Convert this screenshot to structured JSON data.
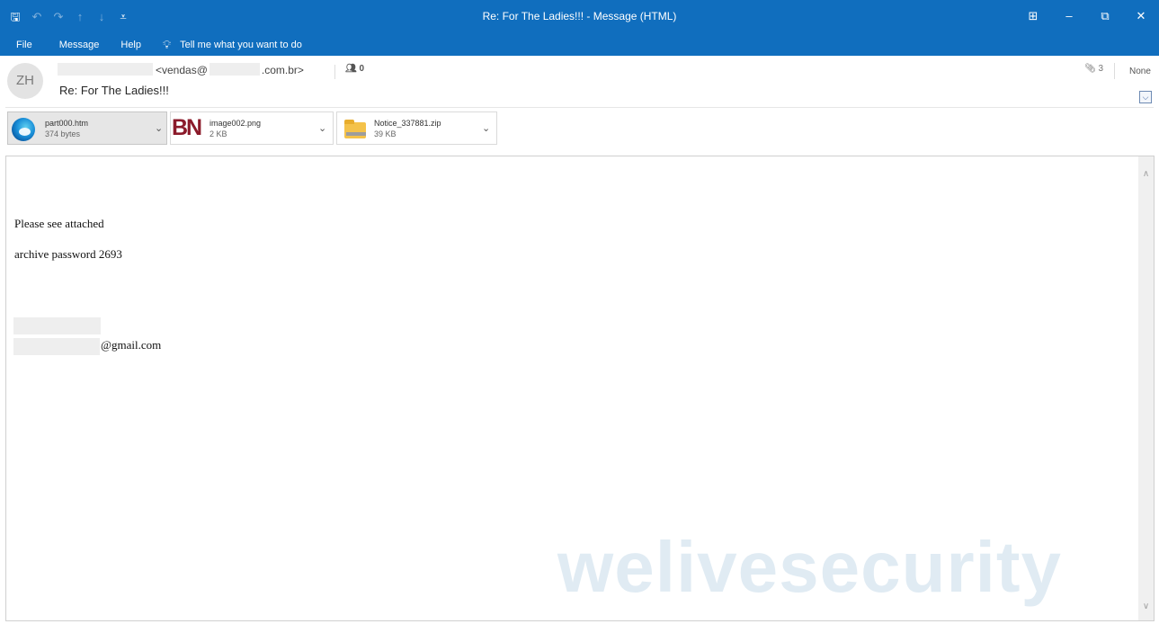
{
  "window": {
    "title": "Re: For The Ladies!!!  -  Message (HTML)",
    "controls": {
      "restore_ribbon": "⊞",
      "minimize": "–",
      "maximize": "⧉",
      "close": "✕"
    }
  },
  "quick_access": {
    "save": "🖫",
    "undo": "↶",
    "redo": "↷",
    "up": "↑",
    "down": "↓",
    "customize": "⩡"
  },
  "menu": {
    "file": "File",
    "message": "Message",
    "help": "Help",
    "tell_me": "Tell me what you want to do"
  },
  "header": {
    "avatar_initials": "ZH",
    "sender_email_prefix": "<vendas@",
    "sender_email_suffix": ".com.br>",
    "people_count": "0",
    "subject": "Re: For The Ladies!!!",
    "attachment_count": "3",
    "sensitivity": "None"
  },
  "attachments": [
    {
      "name": "part000.htm",
      "size": "374 bytes",
      "icon": "edge-icon"
    },
    {
      "name": "image002.png",
      "size": "2 KB",
      "icon": "bn-image-icon",
      "thumb_text": "BN"
    },
    {
      "name": "Notice_337881.zip",
      "size": "39 KB",
      "icon": "zip-folder-icon"
    }
  ],
  "body": {
    "line1": "Please see attached",
    "line2": "archive password 2693",
    "signature_email_suffix": "@gmail.com"
  },
  "watermark": "welivesecurity",
  "colors": {
    "accent": "#106ebe",
    "redaction": "#eeeeee",
    "bn_red": "#8b1a2a"
  }
}
